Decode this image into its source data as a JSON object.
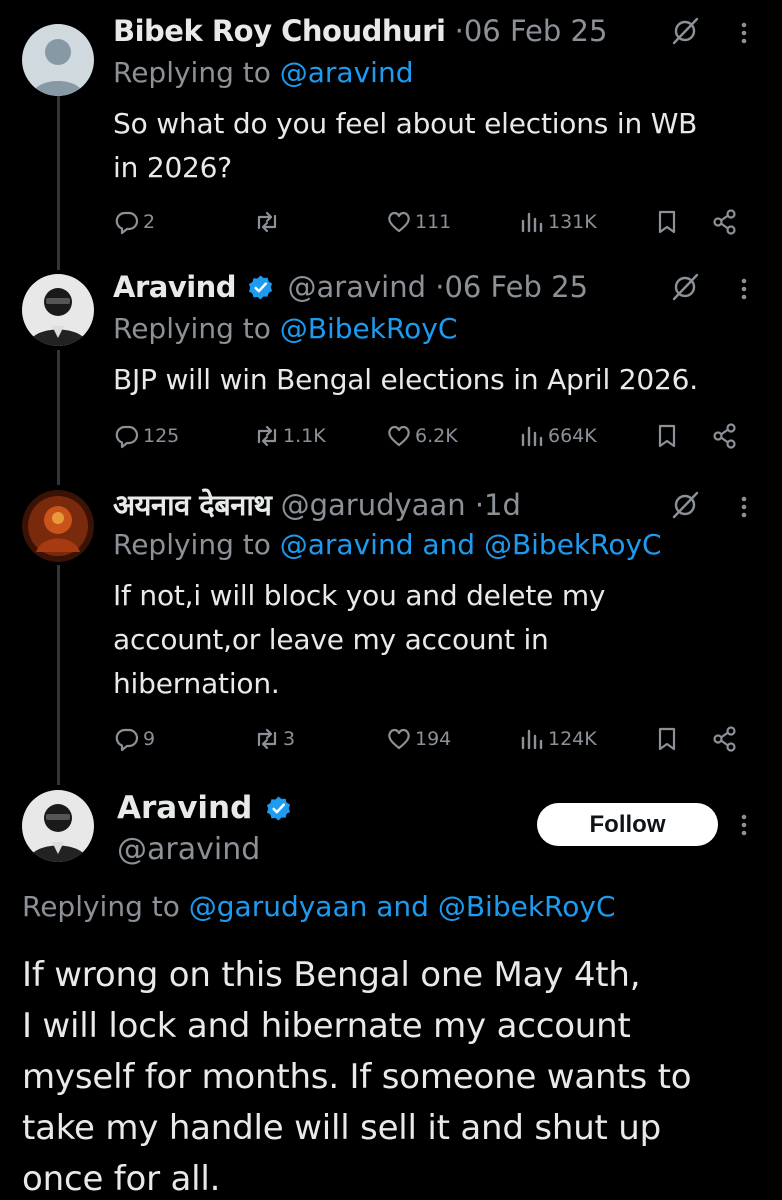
{
  "tweets": [
    {
      "name": "Bibek Roy Choudhuri",
      "separator": "·",
      "date": "06 Feb 25",
      "replying_label": "Replying to",
      "replying_to": "@aravind",
      "text_line1": "So what do you feel about elections in WB",
      "text_line2": "in 2026?",
      "replies": "2",
      "reposts": "",
      "likes": "111",
      "views": "131K"
    },
    {
      "name": "Aravind",
      "handle": "@aravind",
      "separator": "·",
      "date": "06 Feb 25",
      "replying_label": "Replying to",
      "replying_to": "@BibekRoyC",
      "text_line1": "BJP will win Bengal elections in April 2026.",
      "replies": "125",
      "reposts": "1.1K",
      "likes": "6.2K",
      "views": "664K"
    },
    {
      "name": "अयनाव देबनाथ",
      "handle": "@garudyaan",
      "separator": "·",
      "date": "1d",
      "replying_label": "Replying to",
      "replying_to": "@aravind and @BibekRoyC",
      "text_line1": "If not,i will block you and delete my",
      "text_line2": "account,or leave my account in",
      "text_line3": "hibernation.",
      "replies": "9",
      "reposts": "3",
      "likes": "194",
      "views": "124K"
    }
  ],
  "main_tweet": {
    "name": "Aravind",
    "handle": "@aravind",
    "follow_label": "Follow",
    "replying_label": "Replying to",
    "replying_to": "@garudyaan and @BibekRoyC",
    "text_line1": "If wrong on this Bengal one May 4th,",
    "text_line2": "I will lock and hibernate my account",
    "text_line3": "myself for months. If someone wants to",
    "text_line4": "take my handle will sell it and shut up",
    "text_line5": "once for all."
  },
  "colors": {
    "background": "#000000",
    "text": "#e7e9ea",
    "secondary": "#8b9197",
    "mention": "#1d9bf0",
    "verified": "#1d9bf0",
    "follow_button_bg": "#ffffff"
  },
  "icons": [
    "reply-icon",
    "repost-icon",
    "like-icon",
    "views-icon",
    "bookmark-icon",
    "share-icon",
    "grok-icon",
    "more-icon",
    "verified-icon"
  ]
}
